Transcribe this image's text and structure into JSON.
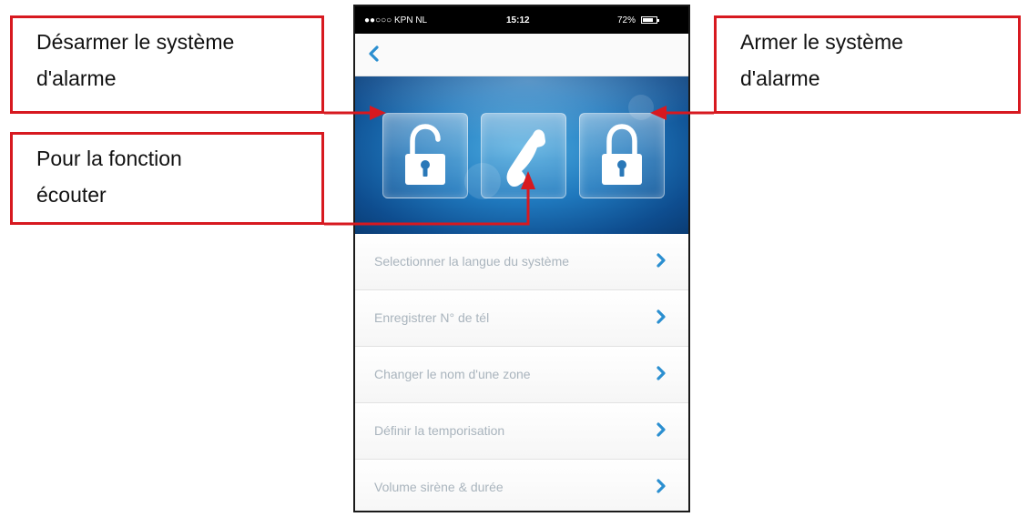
{
  "callouts": {
    "disarm": {
      "line1": "Désarmer le système",
      "line2": "d'alarme"
    },
    "listen": {
      "line1": "Pour la fonction",
      "line2": "écouter"
    },
    "arm": {
      "line1": "Armer le système",
      "line2": "d'alarme"
    }
  },
  "status_bar": {
    "carrier": "●●○○○ KPN NL",
    "time": "15:12",
    "battery": "72%"
  },
  "nav": {
    "back_icon": "chevron-left-icon"
  },
  "tiles": [
    {
      "name": "disarm",
      "icon": "unlocked-padlock-icon"
    },
    {
      "name": "listen",
      "icon": "phone-handset-icon"
    },
    {
      "name": "arm",
      "icon": "locked-padlock-icon"
    }
  ],
  "menu": [
    {
      "label": "Selectionner la langue du système"
    },
    {
      "label": "Enregistrer N° de tél"
    },
    {
      "label": "Changer le nom d'une zone"
    },
    {
      "label": "Définir la temporisation"
    },
    {
      "label": "Volume sirène & durée"
    }
  ],
  "colors": {
    "callout_border": "#d71920",
    "accent": "#2b8fd0",
    "menu_text": "#a9b4bd"
  }
}
